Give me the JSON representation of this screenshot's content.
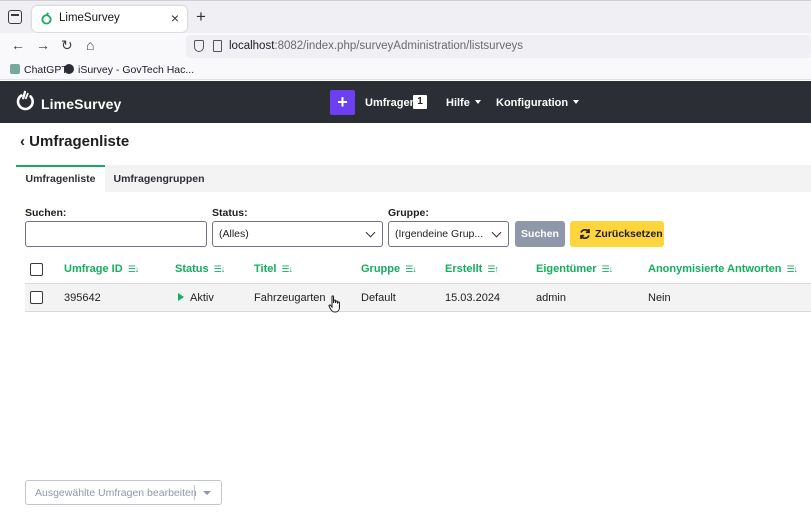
{
  "browser": {
    "tab_title": "LimeSurvey",
    "tab_close": "×",
    "new_tab": "+",
    "url_host": "localhost",
    "url_rest": ":8082/index.php/surveyAdministration/listsurveys",
    "nav_back": "←",
    "nav_forward": "→",
    "nav_reload": "↻",
    "nav_home": "⌂",
    "bookmarks": [
      {
        "label": "ChatGPT",
        "icon_color": "#74aa9c"
      },
      {
        "label": "iSurvey - GovTech Hac...",
        "icon_color": "#2c2e35"
      }
    ]
  },
  "header": {
    "logo_text": "LimeSurvey",
    "add_label": "+",
    "menu_surveys": "Umfragen",
    "surveys_count": "1",
    "menu_help": "Hilfe",
    "menu_config": "Konfiguration"
  },
  "page": {
    "title": "Umfragenliste",
    "back_glyph": "‹",
    "tabs": [
      {
        "label": "Umfragenliste",
        "active": true
      },
      {
        "label": "Umfragengruppen",
        "active": false
      }
    ]
  },
  "filters": {
    "search_label": "Suchen:",
    "search_value": "",
    "status_label": "Status:",
    "status_value": "(Alles)",
    "group_label": "Gruppe:",
    "group_value": "(Irgendeine Grup...",
    "search_button": "Suchen",
    "reset_button": "Zurücksetzen"
  },
  "table": {
    "columns": [
      "Umfrage ID",
      "Status",
      "Titel",
      "Gruppe",
      "Erstellt",
      "Eigentümer",
      "Anonymisierte Antworten"
    ],
    "rows": [
      {
        "id": "395642",
        "status": "Aktiv",
        "title": "Fahrzeugarten",
        "group": "Default",
        "created": "15.03.2024",
        "owner": "admin",
        "anonymized": "Nein"
      }
    ]
  },
  "bulk": {
    "label": "Ausgewählte Umfragen bearbeiten"
  },
  "colors": {
    "accent": "#14ae5c",
    "primary": "#6c3ff0",
    "header_bg": "#2c2e35",
    "reset_bg": "#ffd53e"
  }
}
